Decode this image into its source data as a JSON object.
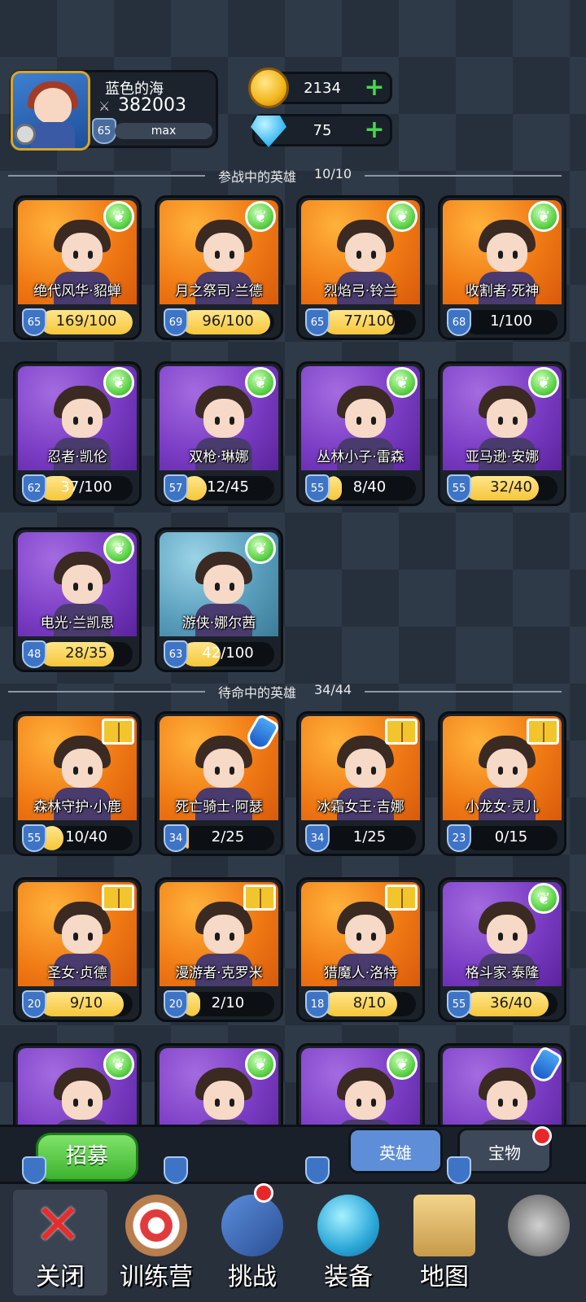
{
  "player": {
    "name": "蓝色的海",
    "power": "382003",
    "level": "65",
    "exp": "max"
  },
  "currency": {
    "gold": "2134",
    "gems": "75"
  },
  "active_section": {
    "label": "参战中的英雄",
    "count": "10/10"
  },
  "standby_section": {
    "label": "待命中的英雄",
    "count": "34/44"
  },
  "active_heroes": [
    {
      "name": "绝代风华·貂蝉",
      "level": "65",
      "progress": "169/100",
      "fill": 1.0,
      "bg": "orange",
      "badge": "leaf"
    },
    {
      "name": "月之祭司·兰德",
      "level": "69",
      "progress": "96/100",
      "fill": 0.96,
      "bg": "orange",
      "badge": "leaf"
    },
    {
      "name": "烈焰弓·铃兰",
      "level": "65",
      "progress": "77/100",
      "fill": 0.77,
      "bg": "orange",
      "badge": "leaf"
    },
    {
      "name": "收割者·死神",
      "level": "68",
      "progress": "1/100",
      "fill": 0.01,
      "bg": "orange",
      "badge": "leaf"
    },
    {
      "name": "忍者·凯伦",
      "level": "62",
      "progress": "37/100",
      "fill": 0.37,
      "bg": "purple",
      "badge": "leaf"
    },
    {
      "name": "双枪·琳娜",
      "level": "57",
      "progress": "12/45",
      "fill": 0.27,
      "bg": "purple",
      "badge": "leaf"
    },
    {
      "name": "丛林小子·雷森",
      "level": "55",
      "progress": "8/40",
      "fill": 0.2,
      "bg": "purple",
      "badge": "leaf"
    },
    {
      "name": "亚马逊·安娜",
      "level": "55",
      "progress": "32/40",
      "fill": 0.8,
      "bg": "purple",
      "badge": "leaf"
    },
    {
      "name": "电光·兰凯思",
      "level": "48",
      "progress": "28/35",
      "fill": 0.8,
      "bg": "purple",
      "badge": "leaf"
    },
    {
      "name": "游侠·娜尔茜",
      "level": "63",
      "progress": "42/100",
      "fill": 0.42,
      "bg": "teal",
      "badge": "leaf"
    }
  ],
  "standby_heroes": [
    {
      "name": "森林守护·小鹿",
      "level": "55",
      "progress": "10/40",
      "fill": 0.25,
      "bg": "orange",
      "badge": "book"
    },
    {
      "name": "死亡骑士·阿瑟",
      "level": "34",
      "progress": "2/25",
      "fill": 0.08,
      "bg": "orange",
      "badge": "potion"
    },
    {
      "name": "冰霜女王·吉娜",
      "level": "34",
      "progress": "1/25",
      "fill": 0.04,
      "bg": "orange",
      "badge": "book"
    },
    {
      "name": "小龙女·灵儿",
      "level": "23",
      "progress": "0/15",
      "fill": 0,
      "bg": "orange",
      "badge": "book"
    },
    {
      "name": "圣女·贞德",
      "level": "20",
      "progress": "9/10",
      "fill": 0.9,
      "bg": "orange",
      "badge": "book"
    },
    {
      "name": "漫游者·克罗米",
      "level": "20",
      "progress": "2/10",
      "fill": 0.2,
      "bg": "orange",
      "badge": "book"
    },
    {
      "name": "猎魔人·洛特",
      "level": "18",
      "progress": "8/10",
      "fill": 0.8,
      "bg": "orange",
      "badge": "book"
    },
    {
      "name": "格斗家·泰隆",
      "level": "55",
      "progress": "36/40",
      "fill": 0.9,
      "bg": "purple",
      "badge": "leaf"
    },
    {
      "name": "",
      "level": "",
      "progress": "",
      "fill": 0,
      "bg": "purple",
      "badge": "leaf"
    },
    {
      "name": "",
      "level": "",
      "progress": "",
      "fill": 0,
      "bg": "purple",
      "badge": "leaf"
    },
    {
      "name": "",
      "level": "",
      "progress": "",
      "fill": 0,
      "bg": "purple",
      "badge": "leaf"
    },
    {
      "name": "",
      "level": "",
      "progress": "",
      "fill": 0,
      "bg": "purple",
      "badge": "potion"
    }
  ],
  "actions": {
    "recruit": "招募",
    "tab_heroes": "英雄",
    "tab_treasures": "宝物"
  },
  "nav": [
    {
      "label": "关闭",
      "icon": "close-icon"
    },
    {
      "label": "训练营",
      "icon": "training-target-icon"
    },
    {
      "label": "挑战",
      "icon": "sword-icon"
    },
    {
      "label": "装备",
      "icon": "armor-icon"
    },
    {
      "label": "地图",
      "icon": "map-icon"
    },
    {
      "label": "",
      "icon": "locked-icon"
    }
  ],
  "colors": {
    "gold": "#f6c63a",
    "accent_blue": "#5f8ed8",
    "green": "#43d94b",
    "red": "#e8272b"
  }
}
